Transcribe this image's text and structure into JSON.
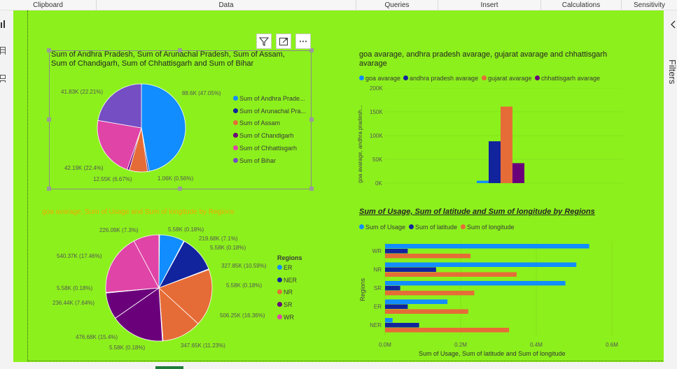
{
  "ribbon": {
    "items": [
      {
        "label": "Clipboard"
      },
      {
        "label": "Data"
      },
      {
        "label": "Queries"
      },
      {
        "label": "Insert"
      },
      {
        "label": "Calculations"
      },
      {
        "label": "Sensitivity"
      }
    ]
  },
  "right_pane": {
    "label": "Filters"
  },
  "visual_header": {
    "filter_icon": "filter-icon",
    "focus_icon": "focus-mode-icon",
    "more_label": "⋯"
  },
  "chart1": {
    "title_line1": "Sum of Andhra Pradesh, Sum of Arunachal Pradesh, Sum of Assam,",
    "title_line2": "Sum of Chandigarh, Sum of Chhattisgarh and Sum of Bihar",
    "labels": [
      "88.6K (47.05%)",
      "1.06K (0.56%)",
      "12.55K (6.67%)",
      "42.19K (22.4%)",
      "41.83K (22.21%)"
    ],
    "legend": [
      "Sum of Andhra Prade...",
      "Sum of Arunachal Pra...",
      "Sum of Assam",
      "Sum of Chandigarh",
      "Sum of Chhattisgarh",
      "Sum of Bihar"
    ]
  },
  "chart2": {
    "title_line1": "goa avarage, andhra pradesh avarage, gujarat avarage and chhattisgarh",
    "title_line2": "avarage",
    "legend": [
      "goa avarage",
      "andhra pradesh avarage",
      "gujarat avarage",
      "chhattisgarh avarage"
    ],
    "yticks": [
      "200K",
      "150K",
      "100K",
      "50K",
      "0K"
    ],
    "ylabel": "goa avarage, andhra pradesh..."
  },
  "chart3": {
    "title": "goa avarage, Sum of Usage and Sum of longitude by Regions",
    "labels": [
      "5.58K (0.18%)",
      "219.68K (7.1%)",
      "5.58K (0.18%)",
      "327.85K (10.59%)",
      "5.58K (0.18%)",
      "506.25K (16.36%)",
      "347.65K (11.23%)",
      "5.58K (0.18%)",
      "476.68K (15.4%)",
      "236.44K (7.64%)",
      "5.58K (0.18%)",
      "540.37K (17.46%)",
      "226.09K (7.3%)"
    ],
    "legend_title": "Regions",
    "legend": [
      "ER",
      "NER",
      "NR",
      "SR",
      "WR"
    ]
  },
  "chart4": {
    "title": "Sum of Usage, Sum of latitude and Sum of longitude by Regions",
    "legend": [
      "Sum of Usage",
      "Sum of latitude",
      "Sum of longitude"
    ],
    "ylabel": "Regions",
    "xlabel": "Sum of Usage, Sum of latitude and Sum of longitude",
    "xticks": [
      "0.0M",
      "0.2M",
      "0.4M",
      "0.6M"
    ]
  },
  "chart_data": [
    {
      "type": "pie",
      "title": "Sum of Andhra Pradesh, Sum of Arunachal Pradesh, Sum of Assam, Sum of Chandigarh, Sum of Chhattisgarh and Sum of Bihar",
      "categories": [
        "Sum of Andhra Pradesh",
        "Sum of Arunachal Pradesh",
        "Sum of Assam",
        "Sum of Chandigarh",
        "Sum of Chhattisgarh",
        "Sum of Bihar"
      ],
      "values": [
        88600,
        1060,
        12550,
        1500,
        42190,
        41830
      ],
      "colors": [
        "#118dff",
        "#12239e",
        "#e66c37",
        "#6b007b",
        "#e044a7",
        "#744ec2"
      ]
    },
    {
      "type": "bar",
      "title": "goa avarage, andhra pradesh avarage, gujarat avarage and chhattisgarh avarage",
      "series": [
        {
          "name": "goa avarage",
          "values": [
            5000
          ]
        },
        {
          "name": "andhra pradesh avarage",
          "values": [
            88000
          ]
        },
        {
          "name": "gujarat avarage",
          "values": [
            161000
          ]
        },
        {
          "name": "chhattisgarh avarage",
          "values": [
            42000
          ]
        }
      ],
      "colors": [
        "#118dff",
        "#12239e",
        "#e66c37",
        "#6b007b"
      ],
      "ylim": [
        0,
        200000
      ]
    },
    {
      "type": "pie",
      "title": "goa avarage, Sum of Usage and Sum of longitude by Regions",
      "values": [
        5580,
        219680,
        5580,
        327850,
        5580,
        506250,
        347650,
        5580,
        476680,
        236440,
        5580,
        540370,
        226090
      ],
      "slice_regions": [
        "ER",
        "ER",
        "NER",
        "NER",
        "NER",
        "NR",
        "NR",
        "SR",
        "SR",
        "SR",
        "WR",
        "WR",
        "WR"
      ],
      "legend_colors": {
        "ER": "#118dff",
        "NER": "#12239e",
        "NR": "#e66c37",
        "SR": "#6b007b",
        "WR": "#e044a7"
      }
    },
    {
      "type": "bar",
      "orientation": "horizontal",
      "title": "Sum of Usage, Sum of latitude and Sum of longitude by Regions",
      "categories": [
        "WR",
        "NR",
        "SR",
        "ER",
        "NER"
      ],
      "series": [
        {
          "name": "Sum of Usage",
          "values": [
            540000,
            506000,
            477000,
            165000,
            20000
          ]
        },
        {
          "name": "Sum of latitude",
          "values": [
            60000,
            135000,
            40000,
            60000,
            90000
          ]
        },
        {
          "name": "Sum of longitude",
          "values": [
            226000,
            348000,
            236000,
            220000,
            328000
          ]
        }
      ],
      "colors": [
        "#118dff",
        "#12239e",
        "#e66c37"
      ],
      "xlim": [
        0,
        600000
      ]
    }
  ]
}
